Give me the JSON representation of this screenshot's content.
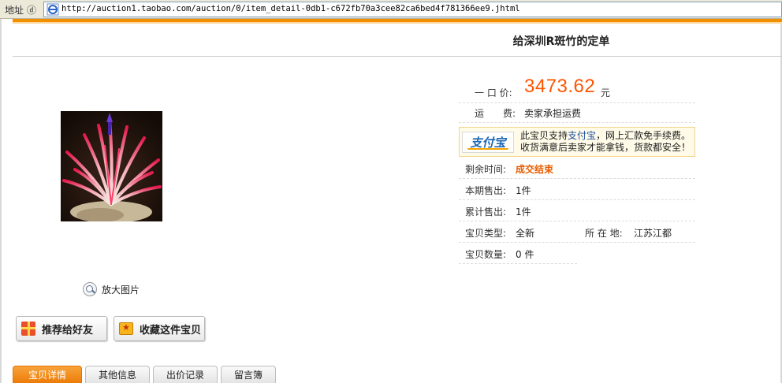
{
  "browser": {
    "address_label": "地址 ⓓ",
    "url": "http://auction1.taobao.com/auction/0/item_detail-0db1-c672fb70a3cee82ca6bed4f781366ee9.jhtml"
  },
  "page": {
    "title": "给深圳R斑竹的定单"
  },
  "price": {
    "label": "一 口 价:",
    "value": "3473.62",
    "unit": "元"
  },
  "shipping": {
    "label": "运　　费:",
    "value": "卖家承担运费"
  },
  "alipay": {
    "logo_text": "支付宝",
    "line1_prefix": "此宝贝支持",
    "line1_link": "支付宝",
    "line1_suffix": "，网上汇款免手续费。",
    "line2": "收货满意后卖家才能拿钱，货款都安全！"
  },
  "details": {
    "remaining_label": "剩余时间:",
    "remaining_value": "成交结束",
    "period_sold_label": "本期售出:",
    "period_sold_value": "1件",
    "total_sold_label": "累计售出:",
    "total_sold_value": "1件",
    "type_label": "宝贝类型:",
    "type_value": "全新",
    "location_label": "所 在 地:",
    "location_value": "江苏江都",
    "quantity_label": "宝贝数量:",
    "quantity_value": "0 件"
  },
  "image": {
    "zoom_label": "放大图片"
  },
  "actions": {
    "recommend_label": "推荐给好友",
    "favorite_label": "收藏这件宝贝"
  },
  "tabs": [
    {
      "label": "宝贝详情",
      "active": true
    },
    {
      "label": "其他信息",
      "active": false
    },
    {
      "label": "出价记录",
      "active": false
    },
    {
      "label": "留言簿",
      "active": false
    }
  ],
  "colors": {
    "accent_orange": "#f39000",
    "price": "#ff5500",
    "link_blue": "#1e50a2"
  }
}
